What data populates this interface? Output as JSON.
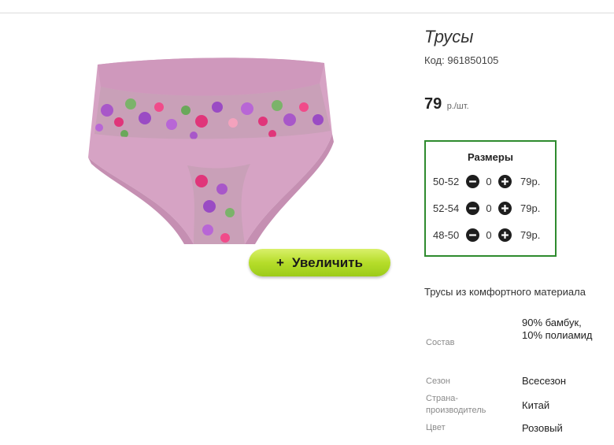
{
  "product": {
    "title": "Трусы",
    "code_label": "Код:",
    "code_value": "961850105",
    "price_value": "79",
    "price_unit": "р./шт.",
    "image_icon": "underwear-photo",
    "colors": {
      "fabric": "#d6a3c4",
      "fabric_dark": "#c58fb2",
      "accent_frame": "#2e8b2e",
      "button": "#b6dd2a"
    }
  },
  "zoom": {
    "label": "Увеличить",
    "icon": "plus-icon"
  },
  "sizes": {
    "title": "Размеры",
    "rows": [
      {
        "size": "50-52",
        "qty": "0",
        "price": "79р."
      },
      {
        "size": "52-54",
        "qty": "0",
        "price": "79р."
      },
      {
        "size": "48-50",
        "qty": "0",
        "price": "79р."
      }
    ]
  },
  "description": "Трусы из комфортного материала",
  "properties": [
    {
      "label": "Состав",
      "value": "90% бамбук, 10% полиамид"
    },
    {
      "label": "Сезон",
      "value": "Всесезон"
    },
    {
      "label": "Страна-производитель",
      "value": "Китай"
    },
    {
      "label": "Цвет",
      "value": "Розовый"
    }
  ]
}
